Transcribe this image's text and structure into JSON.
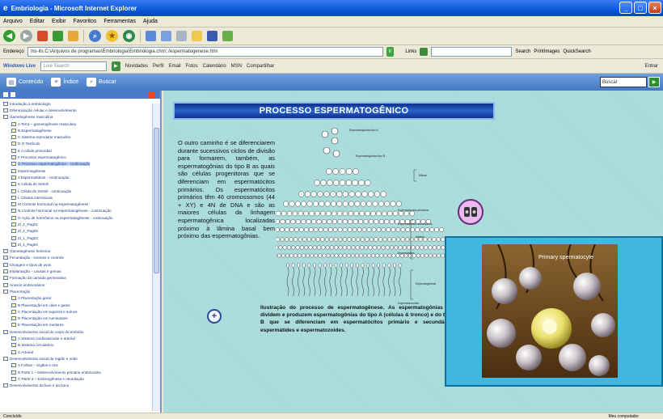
{
  "window": {
    "title": "Embriologia - Microsoft Internet Explorer",
    "colors": {
      "titlebar": "#0a58d8",
      "content_bg": "#a9dbdb",
      "title_banner": "#0d2f8f",
      "sidebar_header": "#4a7ac9"
    }
  },
  "menubar": [
    "Arquivo",
    "Editar",
    "Exibir",
    "Favoritos",
    "Ferramentas",
    "Ajuda"
  ],
  "toolbar": {
    "icons": [
      "back-icon",
      "forward-icon",
      "stop-icon",
      "refresh-icon",
      "home-icon",
      "search-icon",
      "favorites-icon",
      "media-icon",
      "history-icon",
      "mail-icon",
      "print-icon",
      "folder-icon",
      "edit-icon",
      "messenger-icon"
    ]
  },
  "addressbar": {
    "label": "Endereço",
    "url": "ms-its:C:\\Arquivos de programas\\Embriologia\\Embriologia.chm::/espermatogenese.htm",
    "go_label": "Ir",
    "links_label": "Links",
    "search_label": "Search",
    "pagerank_label": "PrintImages",
    "quicksearch_label": "QuickSearch"
  },
  "linksbar": {
    "windows_live": "Windows Live",
    "search_placeholder": "Live Search",
    "items": [
      "Novidades",
      "Perfil",
      "Email",
      "Fotos",
      "Calendário",
      "MSN",
      "Compartilhar"
    ],
    "entrar": "Entrar"
  },
  "chm_toolbar": {
    "conteudo": "Conteúdo",
    "indice": "Índice",
    "buscar": "Buscar",
    "search_value": "Buscar"
  },
  "sidebar": {
    "tree": [
      {
        "label": "Introdução à embriologia",
        "level": 1
      },
      {
        "label": "Diferenciação celular e desenvolvimento",
        "level": 1
      },
      {
        "label": "Gametogênese masculina",
        "level": 1
      },
      {
        "label": "A Terra – gametogênese masculina",
        "level": 2
      },
      {
        "label": "B Espermatogênese",
        "level": 2
      },
      {
        "label": "C Sistema reprodutor masculino",
        "level": 2
      },
      {
        "label": "D O Testículo",
        "level": 2
      },
      {
        "label": "E A célula primordial",
        "level": 2
      },
      {
        "label": "F Processo espermatogênico",
        "level": 2
      },
      {
        "label": "G Processo espermatogênico - continuação",
        "level": 2,
        "selected": true
      },
      {
        "label": "Espermiogênese",
        "level": 2
      },
      {
        "label": "J Espermatídeos - continuação",
        "level": 2
      },
      {
        "label": "K Célula de Sertoli",
        "level": 2
      },
      {
        "label": "L Célula de Sertoli - continuação",
        "level": 2
      },
      {
        "label": "L Células intersticiais",
        "level": 2
      },
      {
        "label": "M Controle hormonal na espermatogênese",
        "level": 2
      },
      {
        "label": "N Controle hormonal na espermatogênese - continuação",
        "level": 2
      },
      {
        "label": "O Ação de hormônios na espermatogênese - continuação",
        "level": 2
      },
      {
        "label": "Zi_1_Pag01",
        "level": 2
      },
      {
        "label": "Zi_1_Pag02",
        "level": 2
      },
      {
        "label": "Zi_1_Pag03",
        "level": 2
      },
      {
        "label": "Zi_1_Pag04",
        "level": 2
      },
      {
        "label": "Gametogênese feminina",
        "level": 1
      },
      {
        "label": "Fecundação - eventos e controle",
        "level": 1
      },
      {
        "label": "Clivagem e tipos de ovos",
        "level": 1
      },
      {
        "label": "Implantação – causas e gemas",
        "level": 1
      },
      {
        "label": "Formação da camada germinativa",
        "level": 1
      },
      {
        "label": "Anexos embrionários",
        "level": 1
      },
      {
        "label": "Placentação",
        "level": 1
      },
      {
        "label": "A Placentação geral",
        "level": 2
      },
      {
        "label": "B Placentação em cães e gatos",
        "level": 2
      },
      {
        "label": "C Placentação em equinos e suínos",
        "level": 2
      },
      {
        "label": "D Placentação em ruminantes",
        "level": 2
      },
      {
        "label": "E Placentação em roedores",
        "level": 2
      },
      {
        "label": "Desenvolvimento inicial do corpo do embrião",
        "level": 1
      },
      {
        "label": "A Sistema cardiovascular e arterial",
        "level": 2
      },
      {
        "label": "B Sistema circulatório",
        "level": 2
      },
      {
        "label": "C Arterial",
        "level": 2
      },
      {
        "label": "Desenvolvimento inicial da região e onde",
        "level": 1
      },
      {
        "label": "A Folhas – órgãos e rins",
        "level": 2
      },
      {
        "label": "B Parte 1 – Desenvolvimento primário embrionário",
        "level": 2
      },
      {
        "label": "C Parte 2 – Embriogênese e neurulação",
        "level": 2
      },
      {
        "label": "Desenvolvimento da face e da boca",
        "level": 1
      }
    ]
  },
  "page": {
    "title": "PROCESSO ESPERMATOGÊNICO",
    "body": "O outro caminho é se diferenciarem durante sucessivos ciclos de divisão para formarem, também, as espermatogônias do tipo B as quais são células progenitoras que se diferenciam em espermatócitos primários. Os espermatócitos primários têm 46 cromossomos (44 + XY) e 4N de DNA e são as maiores células da linhagem espermatogênica localizadas próximo à lâmina basal bem próximo das espermatogônias.",
    "caption": "Ilustração do processo de espermatogênese. As espermatogônias se dividem e produzem espermatogônias do tipo A (células & tronco) e do tipo B que se diferenciam em espermatócitos primário e secundário, espermátides e espermatozoides.",
    "diagram_labels": {
      "a": "Espermatogônias tipo A",
      "b": "Espermatogônias tipo B",
      "mitose": "Mitose",
      "primarios": "Espermatócitos primários",
      "meiose": "Meiose",
      "secundarios": "Espermatócitos secundários",
      "espermatides": "Espermátides",
      "espermiogenese": "Espermiogênese",
      "espermatozoides": "Espermatozoides"
    },
    "video_label": "Primary spermatocyte"
  },
  "statusbar": {
    "left": "Concluído",
    "right": "Meu computador"
  }
}
